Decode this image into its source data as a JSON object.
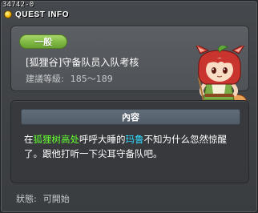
{
  "quest_id": "34742-0",
  "window": {
    "title": "QUEST INFO"
  },
  "header": {
    "category": "一般",
    "quest_name": "[狐狸谷]守备队员入队考核",
    "level_label": "建議等級:",
    "level_range": "185～189"
  },
  "content": {
    "header": "內容",
    "text": {
      "part1": "在",
      "place": "狐狸树高处",
      "part2": "呼呼大睡的",
      "npc": "玛鲁",
      "part3": "不知为什么忽然惊醒了。跟他打听一下尖耳守备队吧。"
    }
  },
  "status": {
    "label": "狀態:",
    "value": "可開始"
  },
  "colors": {
    "place_highlight": "#66ff33",
    "npc_highlight": "#33ddff",
    "badge": "#7fb843"
  },
  "icons": [
    "quest-title-icon",
    "npc-portrait"
  ]
}
